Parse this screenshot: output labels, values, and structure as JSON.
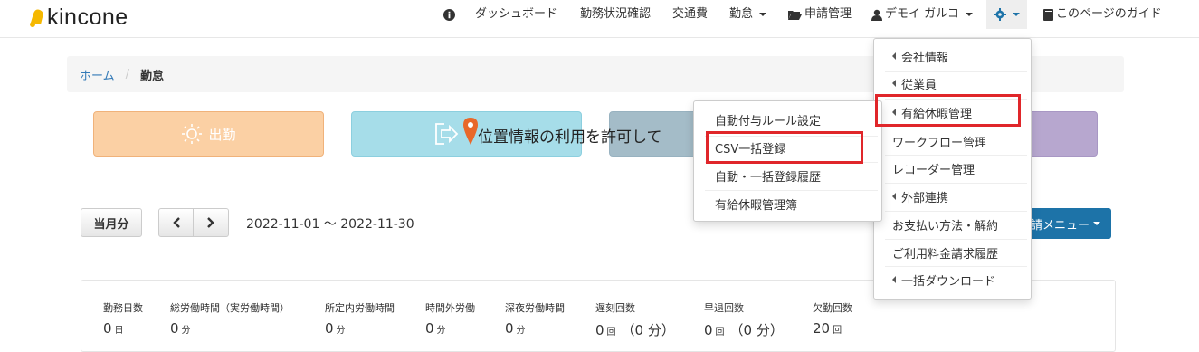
{
  "app": {
    "name": "kincone"
  },
  "nav": {
    "info_icon": "info-circle-icon",
    "dashboard": "ダッシュボード",
    "work_status": "勤務状況確認",
    "transport": "交通費",
    "attendance": "勤怠",
    "requests": "申請管理",
    "user": "デモイ ガルコ",
    "guide": "このページのガイド"
  },
  "breadcrumb": {
    "home": "ホーム",
    "separator": "/",
    "current": "勤怠"
  },
  "actions": {
    "clock_in": "出勤",
    "geolocation_prompt": "位置情報の利用を許可して"
  },
  "period": {
    "current_month": "当月分",
    "date_range": "2022-11-01 〜 2022-11-30",
    "menu_button": "請メニュー"
  },
  "stats": [
    {
      "label": "勤務日数",
      "value": "0",
      "unit": "日"
    },
    {
      "label": "総労働時間（実労働時間）",
      "value": "0",
      "unit": "分"
    },
    {
      "label": "所定内労働時間",
      "value": "0",
      "unit": "分"
    },
    {
      "label": "時間外労働",
      "value": "0",
      "unit": "分"
    },
    {
      "label": "深夜労働時間",
      "value": "0",
      "unit": "分"
    },
    {
      "label": "遅刻回数",
      "value": "0",
      "unit": "回",
      "extra": "（0 分）"
    },
    {
      "label": "早退回数",
      "value": "0",
      "unit": "回",
      "extra": "（0 分）"
    },
    {
      "label": "欠勤回数",
      "value": "20",
      "unit": "回"
    }
  ],
  "settings_menu": {
    "items": [
      "会社情報",
      "従業員",
      "有給休暇管理",
      "ワークフロー管理",
      "レコーダー管理",
      "外部連携",
      "お支払い方法・解約",
      "ご利用料金請求履歴",
      "一括ダウンロード"
    ]
  },
  "leave_submenu": {
    "items": [
      "自動付与ルール設定",
      "CSV一括登録",
      "自動・一括登録履歴",
      "有給休暇管理簿"
    ]
  },
  "colors": {
    "highlight": "#e0262a",
    "link": "#337ab7",
    "primary": "#1d73a8",
    "clock_in": "#fbd0a4",
    "clock_out": "#a6dde9"
  }
}
